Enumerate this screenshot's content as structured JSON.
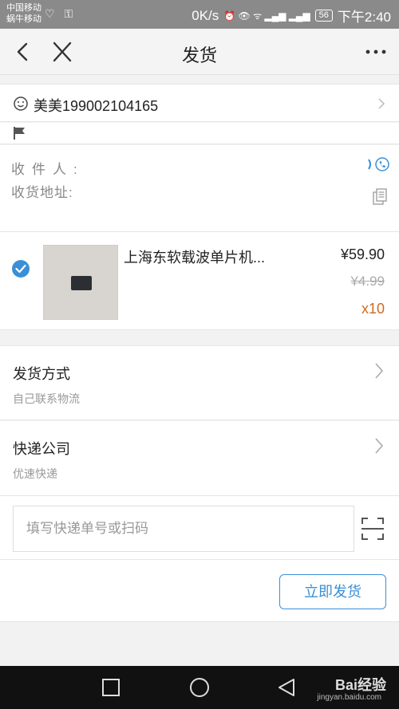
{
  "status_bar": {
    "carrier_line1": "中国移动",
    "carrier_line2": "蜗牛移动",
    "left_icons": "♡ ⚿",
    "speed": "0K/s",
    "signal_icons": "⏰ 👁 ᯤ ▂▄▆ ▂▄▆",
    "battery": "56",
    "time": "下午2:40"
  },
  "navbar": {
    "title": "发货"
  },
  "buyer": {
    "name": "美美199002104165"
  },
  "address": {
    "recipient_label": "收件人:",
    "address_label": "收货地址:"
  },
  "product": {
    "name": "上海东软载波单片机...",
    "price": "¥59.90",
    "original_price": "¥4.99",
    "quantity": "x10"
  },
  "shipping_method": {
    "title": "发货方式",
    "value": "自己联系物流"
  },
  "courier": {
    "title": "快递公司",
    "value": "优速快递"
  },
  "tracking": {
    "placeholder": "填写快递单号或扫码"
  },
  "actions": {
    "ship_now": "立即发货"
  },
  "watermark": {
    "brand": "Bai经验",
    "url": "jingyan.baidu.com"
  },
  "colors": {
    "accent": "#3b8fd6",
    "quantity": "#d2691e",
    "status_bar": "#8a8a8a"
  }
}
